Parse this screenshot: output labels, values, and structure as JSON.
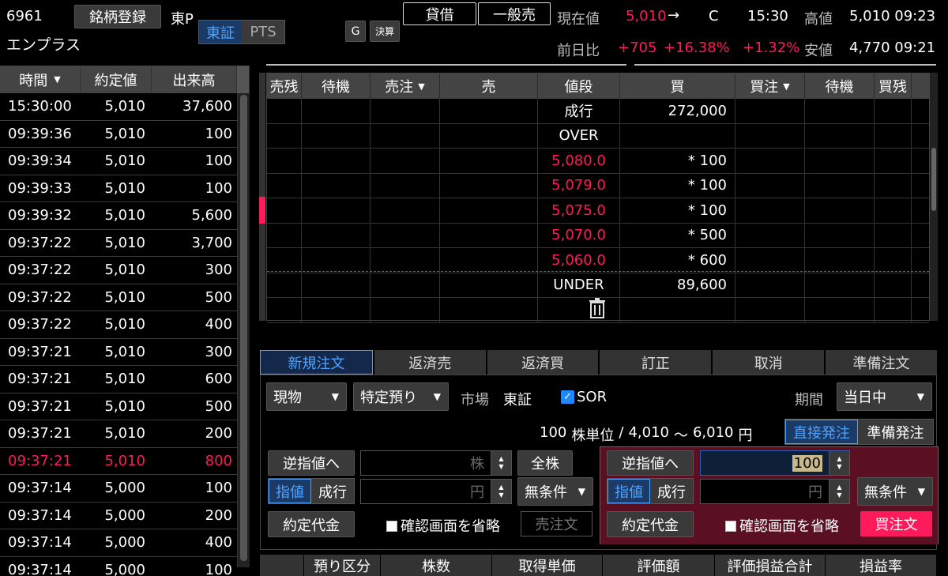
{
  "header": {
    "code": "6961",
    "name": "エンプラス",
    "register_btn": "銘柄登録",
    "market": "東P",
    "toggle": [
      "東証",
      "PTS"
    ],
    "g_btn": "G",
    "settlement_btn": "決算",
    "lending_btn": "貸借",
    "general_sell_btn": "一般売",
    "current_label": "現在値",
    "current_price": "5,010",
    "arrow": "→",
    "c_mark": "C",
    "time": "15:30",
    "high_label": "高値",
    "high_value": "5,010 09:23",
    "change_label": "前日比",
    "change": "+705",
    "change_pct": "+16.38%",
    "change_pct2": "+1.32%",
    "low_label": "安値",
    "low_value": "4,770 09:21"
  },
  "trades": {
    "headers": [
      "時間",
      "約定値",
      "出来高"
    ],
    "rows": [
      [
        "15:30:00",
        "5,010",
        "37,600"
      ],
      [
        "09:39:36",
        "5,010",
        "100"
      ],
      [
        "09:39:34",
        "5,010",
        "100"
      ],
      [
        "09:39:33",
        "5,010",
        "100"
      ],
      [
        "09:39:32",
        "5,010",
        "5,600"
      ],
      [
        "09:37:22",
        "5,010",
        "3,700"
      ],
      [
        "09:37:22",
        "5,010",
        "300"
      ],
      [
        "09:37:22",
        "5,010",
        "500"
      ],
      [
        "09:37:22",
        "5,010",
        "400"
      ],
      [
        "09:37:21",
        "5,010",
        "300"
      ],
      [
        "09:37:21",
        "5,010",
        "600"
      ],
      [
        "09:37:21",
        "5,010",
        "500"
      ],
      [
        "09:37:21",
        "5,010",
        "200"
      ],
      [
        "09:37:21",
        "5,010",
        "800"
      ],
      [
        "09:37:14",
        "5,000",
        "100"
      ],
      [
        "09:37:14",
        "5,000",
        "200"
      ],
      [
        "09:37:14",
        "5,000",
        "400"
      ],
      [
        "09:37:14",
        "5,000",
        "100"
      ]
    ],
    "highlight_row": 13
  },
  "board": {
    "headers": [
      "売残",
      "待機",
      "売注",
      "売",
      "値段",
      "買",
      "買注",
      "待機",
      "買残"
    ],
    "rows": [
      {
        "price": "成行",
        "buy": "272,000",
        "red": false
      },
      {
        "price": "OVER",
        "buy": "",
        "red": false
      },
      {
        "price": "5,080.0",
        "buy": "* 100",
        "red": true
      },
      {
        "price": "5,079.0",
        "buy": "* 100",
        "red": true
      },
      {
        "price": "5,075.0",
        "buy": "* 100",
        "red": true
      },
      {
        "price": "5,070.0",
        "buy": "* 500",
        "red": true
      },
      {
        "price": "5,060.0",
        "buy": "* 600",
        "red": true
      },
      {
        "price": "UNDER",
        "buy": "89,600",
        "red": false
      }
    ]
  },
  "tabs": [
    "新規注文",
    "返済売",
    "返済買",
    "訂正",
    "取消",
    "準備注文"
  ],
  "order": {
    "type_select": "現物",
    "account_select": "特定預り",
    "market_label": "市場",
    "market_value": "東証",
    "sor_label": "SOR",
    "period_label": "期間",
    "period_select": "当日中",
    "unit_qty": "100",
    "unit_label": "株単位",
    "range_sep": "/",
    "range_low": "4,010",
    "range_tilde": "〜",
    "range_high": "6,010",
    "range_unit": "円",
    "direct_btn": "直接発注",
    "prepare_btn": "準備発注",
    "reverse_btn": "逆指値へ",
    "shares_unit": "株",
    "all_shares_btn": "全株",
    "limit_btn": "指値",
    "market_btn": "成行",
    "yen_unit": "円",
    "condition_select": "無条件",
    "amount_btn": "約定代金",
    "skip_confirm": "確認画面を省略",
    "sell_btn": "売注文",
    "buy_qty": "100",
    "buy_btn": "買注文"
  },
  "holdings": {
    "headers": [
      "預り区分",
      "株数",
      "取得単価",
      "評価額",
      "評価損益合計",
      "損益率"
    ]
  },
  "colors": {
    "red": "#ff1a5c",
    "blue": "#4fa3ff",
    "buy_panel": "#5a0f22"
  }
}
